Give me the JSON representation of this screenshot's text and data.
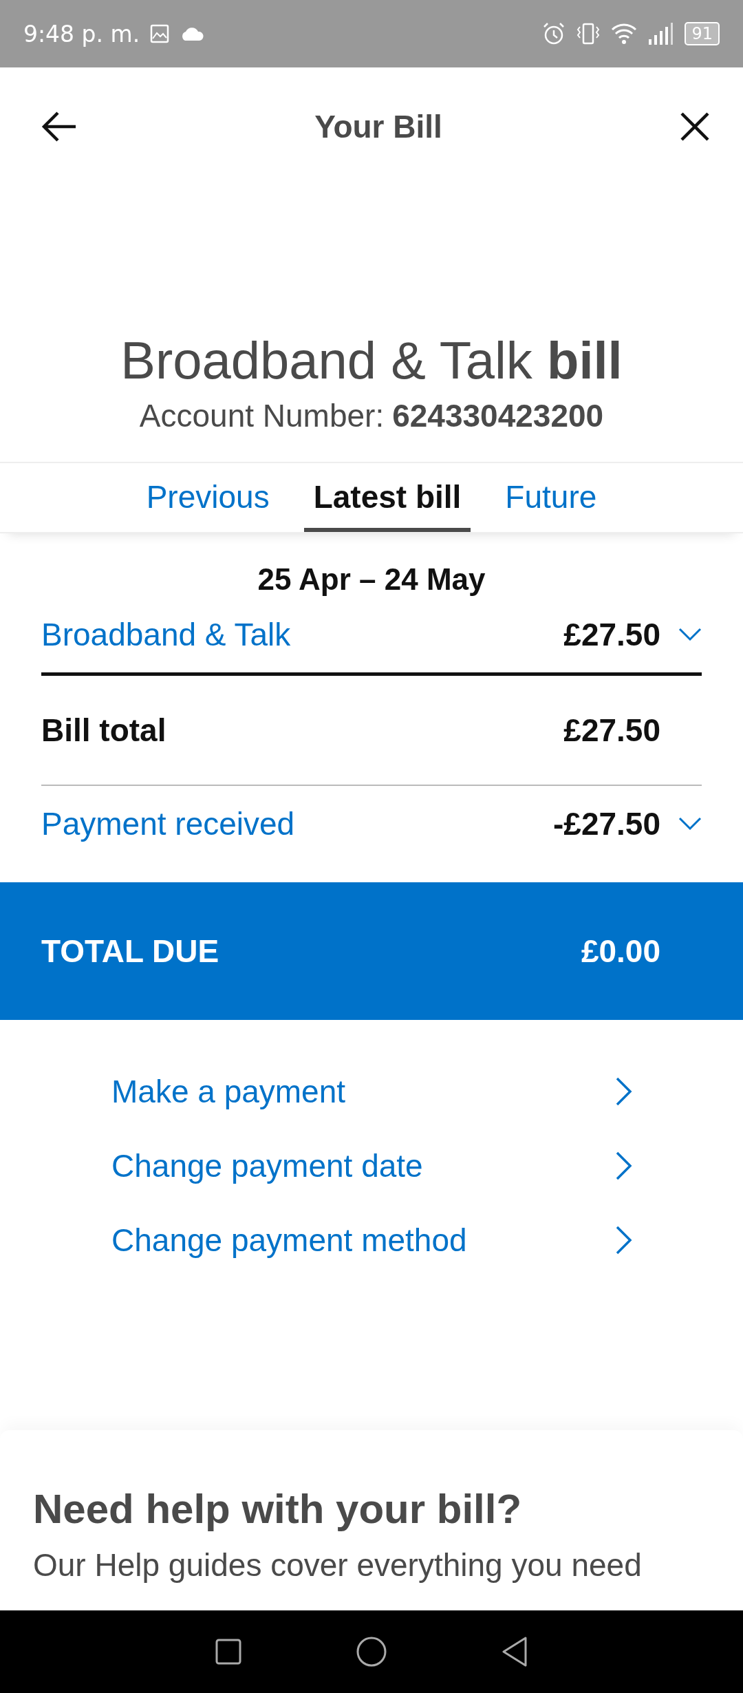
{
  "status_bar": {
    "time": "9:48 p. m.",
    "battery": "91"
  },
  "header": {
    "title": "Your Bill"
  },
  "bill": {
    "title": "Broadband & Talk **bill**",
    "account_label": "Account Number:",
    "account_number": "624330423200"
  },
  "tabs": [
    {
      "label": "Previous",
      "selected": false
    },
    {
      "label": "Latest bill",
      "selected": true
    },
    {
      "label": "Future",
      "selected": false
    }
  ],
  "period": "25 Apr – 24 May",
  "lines": [
    {
      "kind": "expandable",
      "label": "Broadband & Talk",
      "amount": "£27.50",
      "expanded": false
    },
    {
      "kind": "total",
      "label": "Bill total",
      "amount": "£27.50"
    },
    {
      "kind": "expandable",
      "label": "Payment received",
      "amount": "-£27.50",
      "expanded": false
    }
  ],
  "total_due": {
    "label": "TOTAL DUE",
    "amount": "£0.00"
  },
  "actions": [
    "Make a payment",
    "Change payment date",
    "Change payment method"
  ],
  "help": {
    "heading": "Need help with your bill?",
    "text": "Our Help guides cover everything you need"
  }
}
